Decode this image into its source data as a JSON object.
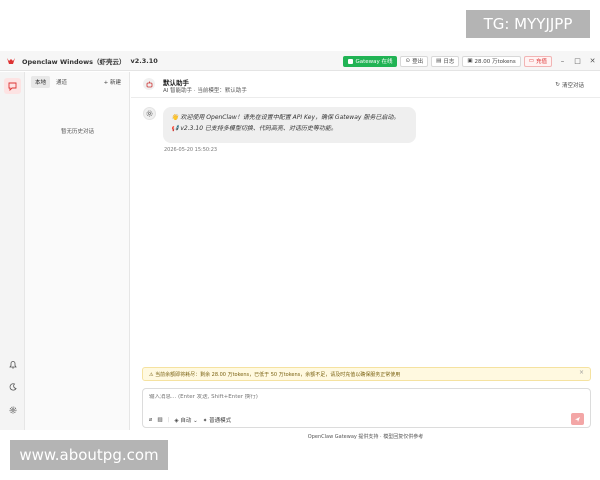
{
  "watermarks": {
    "top": "TG: MYYJJPP",
    "bottom": "www.aboutpg.com"
  },
  "window": {
    "title": "Openclaw Windows（虾壳云）",
    "version": "v2.3.10",
    "gateway_badge": "Gateway 在线",
    "buttons": {
      "logout": "登出",
      "log": "日志",
      "tokens": "28.00 万tokens",
      "recharge": "充值"
    },
    "controls": {
      "minimize": "–",
      "maximize": "□",
      "close": "✕"
    }
  },
  "sessions": {
    "tabs": [
      {
        "label": "本地",
        "active": true
      },
      {
        "label": "通道",
        "active": false
      }
    ],
    "new_label": "+ 新建",
    "empty_text": "暂无历史对话"
  },
  "chat": {
    "title": "默认助手",
    "subtitle": "AI 智能助手 · 当前模型：默认助手",
    "clear_label": "清空对话",
    "message_line1": "👋 欢迎使用 OpenClaw！请先在设置中配置 API Key，确保 Gateway 服务已启动。",
    "message_line2": "📢 v2.3.10 已支持多模型切换、代码高亮、对话历史等功能。",
    "message_time": "2026-05-20 15:50:23"
  },
  "warning": {
    "text": "⚠ 当前余额即将耗尽：剩余 28.00 万tokens，已低于 50 万tokens，余额不足，请及时充值以确保服务正常使用",
    "close": "×"
  },
  "composer": {
    "placeholder": "输入消息... (Enter 发送, Shift+Enter 换行)",
    "auto_label": "自动",
    "mode_label": "普通模式"
  },
  "footer": "OpenClaw Gateway 提供支持 · 模型回复仅供参考",
  "colors": {
    "accent": "#d33333",
    "gateway": "#21b354",
    "warn_bg": "#fff9e0"
  }
}
